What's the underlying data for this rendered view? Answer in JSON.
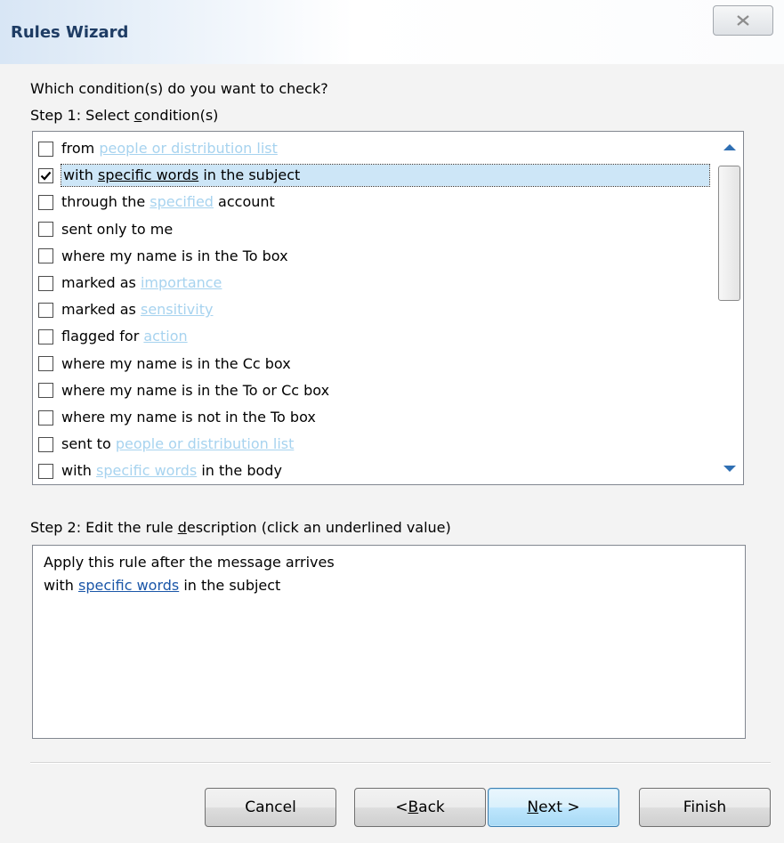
{
  "window": {
    "title": "Rules Wizard",
    "close_icon": "close-icon"
  },
  "question": "Which condition(s) do you want to check?",
  "step1": {
    "prefix": "Step 1: Select ",
    "accel": "c",
    "suffix": "ondition(s)"
  },
  "conditions": [
    {
      "checked": false,
      "selected": false,
      "parts": [
        "from ",
        "people or distribution list",
        ""
      ]
    },
    {
      "checked": true,
      "selected": true,
      "parts": [
        "with ",
        "specific words",
        " in the subject"
      ]
    },
    {
      "checked": false,
      "selected": false,
      "parts": [
        "through the ",
        "specified",
        " account"
      ]
    },
    {
      "checked": false,
      "selected": false,
      "parts": [
        "sent only to me",
        "",
        ""
      ]
    },
    {
      "checked": false,
      "selected": false,
      "parts": [
        "where my name is in the To box",
        "",
        ""
      ]
    },
    {
      "checked": false,
      "selected": false,
      "parts": [
        "marked as ",
        "importance",
        ""
      ]
    },
    {
      "checked": false,
      "selected": false,
      "parts": [
        "marked as ",
        "sensitivity",
        ""
      ]
    },
    {
      "checked": false,
      "selected": false,
      "parts": [
        "flagged for ",
        "action",
        ""
      ]
    },
    {
      "checked": false,
      "selected": false,
      "parts": [
        "where my name is in the Cc box",
        "",
        ""
      ]
    },
    {
      "checked": false,
      "selected": false,
      "parts": [
        "where my name is in the To or Cc box",
        "",
        ""
      ]
    },
    {
      "checked": false,
      "selected": false,
      "parts": [
        "where my name is not in the To box",
        "",
        ""
      ]
    },
    {
      "checked": false,
      "selected": false,
      "parts": [
        "sent to ",
        "people or distribution list",
        ""
      ]
    },
    {
      "checked": false,
      "selected": false,
      "parts": [
        "with ",
        "specific words",
        " in the body"
      ]
    }
  ],
  "step2": {
    "prefix": "Step 2: Edit the rule ",
    "accel": "d",
    "suffix": "escription (click an underlined value)"
  },
  "description": {
    "line1": "Apply this rule after the message arrives",
    "line2_prefix": "with ",
    "line2_link": "specific words",
    "line2_suffix": " in the subject"
  },
  "buttons": {
    "cancel": "Cancel",
    "back_prefix": "< ",
    "back_accel": "B",
    "back_suffix": "ack",
    "next_accel": "N",
    "next_suffix": "ext >",
    "finish": "Finish"
  },
  "colors": {
    "faint_link": "#a7d3ef",
    "desc_link": "#1a56a8",
    "selection": "#cde6f7",
    "scroll_arrow": "#2f6fb3"
  }
}
